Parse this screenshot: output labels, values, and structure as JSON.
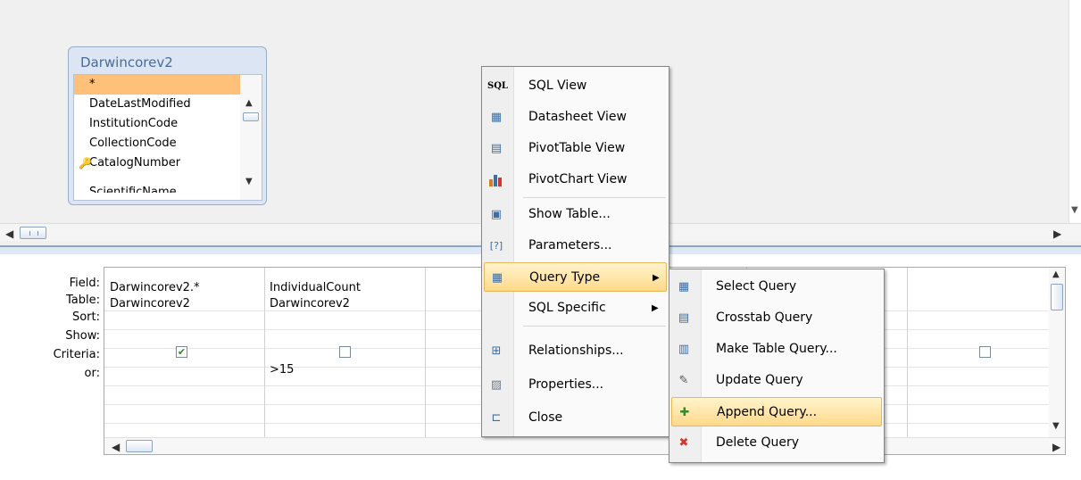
{
  "table_window": {
    "title": "Darwincorev2",
    "fields": [
      "*",
      "DateLastModified",
      "InstitutionCode",
      "CollectionCode",
      "CatalogNumber",
      "ScientificName"
    ]
  },
  "grid": {
    "row_labels": [
      "Field:",
      "Table:",
      "Sort:",
      "Show:",
      "Criteria:",
      "or:"
    ],
    "columns": [
      {
        "field": "Darwincorev2.*",
        "table": "Darwincorev2",
        "show": true,
        "criteria": ""
      },
      {
        "field": "IndividualCount",
        "table": "Darwincorev2",
        "show": false,
        "criteria": ">15"
      }
    ],
    "checkmark": "✔"
  },
  "context_menu": {
    "items": [
      {
        "icon": "SQL",
        "label": "SQL View"
      },
      {
        "icon": "datasheet-view-icon",
        "label": "Datasheet View"
      },
      {
        "icon": "pivottable-icon",
        "label": "PivotTable View"
      },
      {
        "icon": "pivotchart-icon",
        "label": "PivotChart View"
      },
      {
        "icon": "show-table-icon",
        "label": "Show Table..."
      },
      {
        "icon": "parameters-icon",
        "label": "Parameters..."
      },
      {
        "icon": "query-type-icon",
        "label": "Query Type"
      },
      {
        "icon": "",
        "label": "SQL Specific"
      },
      {
        "icon": "relationships-icon",
        "label": "Relationships..."
      },
      {
        "icon": "properties-icon",
        "label": "Properties..."
      },
      {
        "icon": "close-icon",
        "label": "Close"
      }
    ]
  },
  "submenu": {
    "items": [
      {
        "icon": "select-query-icon",
        "label": "Select Query"
      },
      {
        "icon": "crosstab-query-icon",
        "label": "Crosstab Query"
      },
      {
        "icon": "make-table-query-icon",
        "label": "Make Table Query..."
      },
      {
        "icon": "update-query-icon",
        "label": "Update Query"
      },
      {
        "icon": "append-query-icon",
        "label": "Append Query..."
      },
      {
        "icon": "delete-query-icon",
        "label": "Delete Query"
      }
    ]
  },
  "colors": {
    "selection_orange": "#ffc07a",
    "menu_highlight": "#ffd98a",
    "window_title": "#4a6c96"
  }
}
